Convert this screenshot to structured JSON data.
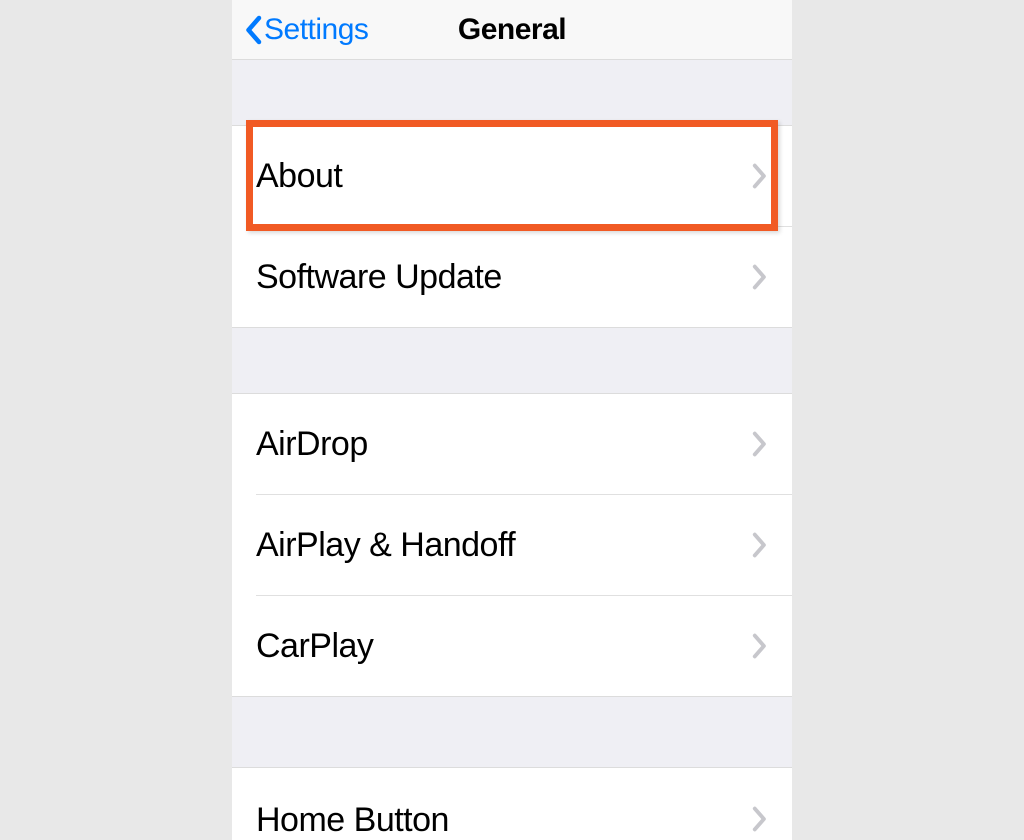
{
  "navbar": {
    "back_label": "Settings",
    "title": "General"
  },
  "groups": [
    {
      "items": [
        {
          "label": "About",
          "highlighted": true
        },
        {
          "label": "Software Update"
        }
      ]
    },
    {
      "items": [
        {
          "label": "AirDrop"
        },
        {
          "label": "AirPlay & Handoff"
        },
        {
          "label": "CarPlay"
        }
      ]
    },
    {
      "items": [
        {
          "label": "Home Button"
        }
      ]
    }
  ],
  "colors": {
    "accent": "#007aff",
    "highlight": "#f15a24"
  }
}
